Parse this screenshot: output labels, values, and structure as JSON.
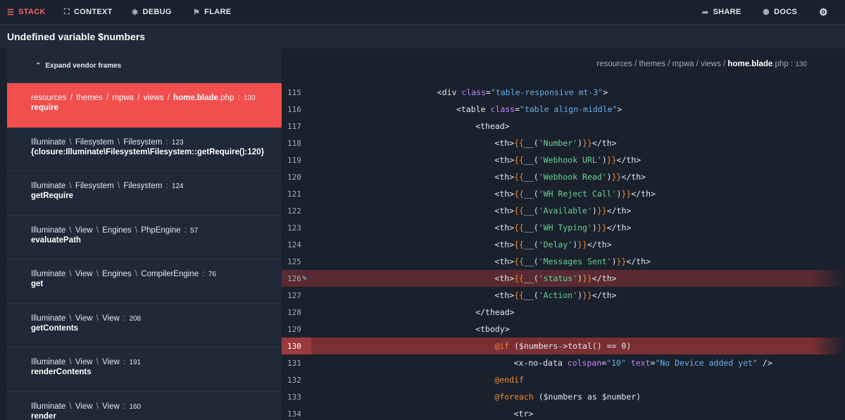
{
  "topnav": {
    "left": [
      {
        "label": "STACK",
        "icon": "list-icon",
        "glyph": "☰",
        "active": true
      },
      {
        "label": "CONTEXT",
        "icon": "expand-icon",
        "glyph": "⛶",
        "active": false
      },
      {
        "label": "DEBUG",
        "icon": "bug-icon",
        "glyph": "✱",
        "active": false
      },
      {
        "label": "FLARE",
        "icon": "flare-icon",
        "glyph": "⚑",
        "active": false
      }
    ],
    "right": [
      {
        "label": "SHARE",
        "icon": "share-icon",
        "glyph": "➦"
      },
      {
        "label": "DOCS",
        "icon": "docs-icon",
        "glyph": "⚉"
      }
    ],
    "settings_icon": "gear-icon",
    "settings_glyph": "⚙"
  },
  "title": "Undefined variable $numbers",
  "sidebar": {
    "expand_label": "Expand vendor frames",
    "expand_glyph": "⌃",
    "frames": [
      {
        "path": [
          "resources",
          "themes",
          "mpwa",
          "views"
        ],
        "file": "home.blade.php",
        "line": "130",
        "method": "require",
        "active": true
      },
      {
        "path": [
          "Illuminate",
          "Filesystem",
          "Filesystem"
        ],
        "file": "",
        "line": "123",
        "method": "{closure:Illuminate\\Filesystem\\Filesystem::getRequire():120}",
        "active": false
      },
      {
        "path": [
          "Illuminate",
          "Filesystem",
          "Filesystem"
        ],
        "file": "",
        "line": "124",
        "method": "getRequire",
        "active": false
      },
      {
        "path": [
          "Illuminate",
          "View",
          "Engines",
          "PhpEngine"
        ],
        "file": "",
        "line": "57",
        "method": "evaluatePath",
        "active": false
      },
      {
        "path": [
          "Illuminate",
          "View",
          "Engines",
          "CompilerEngine"
        ],
        "file": "",
        "line": "76",
        "method": "get",
        "active": false
      },
      {
        "path": [
          "Illuminate",
          "View",
          "View"
        ],
        "file": "",
        "line": "208",
        "method": "getContents",
        "active": false
      },
      {
        "path": [
          "Illuminate",
          "View",
          "View"
        ],
        "file": "",
        "line": "191",
        "method": "renderContents",
        "active": false
      },
      {
        "path": [
          "Illuminate",
          "View",
          "View"
        ],
        "file": "",
        "line": "160",
        "method": "render",
        "active": false
      }
    ]
  },
  "code": {
    "breadcrumb": {
      "path": [
        "resources",
        "themes",
        "mpwa",
        "views"
      ],
      "file": "home.blade",
      "ext": ".php",
      "line": "130"
    },
    "highlight_line": "130",
    "edit_line": "126",
    "lines": [
      {
        "n": "115",
        "indent": 16,
        "t": [
          [
            "tg",
            "<div "
          ],
          [
            "at",
            "class"
          ],
          [
            "tg",
            "="
          ],
          [
            "av",
            "\"table-responsive mt-3\""
          ],
          [
            "tg",
            ">"
          ]
        ]
      },
      {
        "n": "116",
        "indent": 20,
        "t": [
          [
            "tg",
            "<table "
          ],
          [
            "at",
            "class"
          ],
          [
            "tg",
            "="
          ],
          [
            "av",
            "\"table align-middle\""
          ],
          [
            "tg",
            ">"
          ]
        ]
      },
      {
        "n": "117",
        "indent": 24,
        "t": [
          [
            "tg",
            "<thead>"
          ]
        ]
      },
      {
        "n": "118",
        "indent": 28,
        "t": [
          [
            "tg",
            "<th>"
          ],
          [
            "sm",
            "{{"
          ],
          [
            "fn",
            "__("
          ],
          [
            "st",
            "'Number'"
          ],
          [
            "fn",
            ")"
          ],
          [
            "sm",
            "}}"
          ],
          [
            "tg",
            "</th>"
          ]
        ]
      },
      {
        "n": "119",
        "indent": 28,
        "t": [
          [
            "tg",
            "<th>"
          ],
          [
            "sm",
            "{{"
          ],
          [
            "fn",
            "__("
          ],
          [
            "st",
            "'Webhook URL'"
          ],
          [
            "fn",
            ")"
          ],
          [
            "sm",
            "}}"
          ],
          [
            "tg",
            "</th>"
          ]
        ]
      },
      {
        "n": "120",
        "indent": 28,
        "t": [
          [
            "tg",
            "<th>"
          ],
          [
            "sm",
            "{{"
          ],
          [
            "fn",
            "__("
          ],
          [
            "st",
            "'Webhook Read'"
          ],
          [
            "fn",
            ")"
          ],
          [
            "sm",
            "}}"
          ],
          [
            "tg",
            "</th>"
          ]
        ]
      },
      {
        "n": "121",
        "indent": 28,
        "t": [
          [
            "tg",
            "<th>"
          ],
          [
            "sm",
            "{{"
          ],
          [
            "fn",
            "__("
          ],
          [
            "st",
            "'WH Reject Call'"
          ],
          [
            "fn",
            ")"
          ],
          [
            "sm",
            "}}"
          ],
          [
            "tg",
            "</th>"
          ]
        ]
      },
      {
        "n": "122",
        "indent": 28,
        "t": [
          [
            "tg",
            "<th>"
          ],
          [
            "sm",
            "{{"
          ],
          [
            "fn",
            "__("
          ],
          [
            "st",
            "'Available'"
          ],
          [
            "fn",
            ")"
          ],
          [
            "sm",
            "}}"
          ],
          [
            "tg",
            "</th>"
          ]
        ]
      },
      {
        "n": "123",
        "indent": 28,
        "t": [
          [
            "tg",
            "<th>"
          ],
          [
            "sm",
            "{{"
          ],
          [
            "fn",
            "__("
          ],
          [
            "st",
            "'WH Typing'"
          ],
          [
            "fn",
            ")"
          ],
          [
            "sm",
            "}}"
          ],
          [
            "tg",
            "</th>"
          ]
        ]
      },
      {
        "n": "124",
        "indent": 28,
        "t": [
          [
            "tg",
            "<th>"
          ],
          [
            "sm",
            "{{"
          ],
          [
            "fn",
            "__("
          ],
          [
            "st",
            "'Delay'"
          ],
          [
            "fn",
            ")"
          ],
          [
            "sm",
            "}}"
          ],
          [
            "tg",
            "</th>"
          ]
        ]
      },
      {
        "n": "125",
        "indent": 28,
        "t": [
          [
            "tg",
            "<th>"
          ],
          [
            "sm",
            "{{"
          ],
          [
            "fn",
            "__("
          ],
          [
            "st",
            "'Messages Sent'"
          ],
          [
            "fn",
            ")"
          ],
          [
            "sm",
            "}}"
          ],
          [
            "tg",
            "</th>"
          ]
        ]
      },
      {
        "n": "126",
        "indent": 28,
        "t": [
          [
            "tg",
            "<th>"
          ],
          [
            "sm",
            "{{"
          ],
          [
            "fn",
            "__("
          ],
          [
            "st",
            "'status'"
          ],
          [
            "fn",
            ")"
          ],
          [
            "sm",
            "}}"
          ],
          [
            "tg",
            "</th>"
          ]
        ]
      },
      {
        "n": "127",
        "indent": 28,
        "t": [
          [
            "tg",
            "<th>"
          ],
          [
            "sm",
            "{{"
          ],
          [
            "fn",
            "__("
          ],
          [
            "st",
            "'Action'"
          ],
          [
            "fn",
            ")"
          ],
          [
            "sm",
            "}}"
          ],
          [
            "tg",
            "</th>"
          ]
        ]
      },
      {
        "n": "128",
        "indent": 24,
        "t": [
          [
            "tg",
            "</thead>"
          ]
        ]
      },
      {
        "n": "129",
        "indent": 24,
        "t": [
          [
            "tg",
            "<tbody>"
          ]
        ]
      },
      {
        "n": "130",
        "indent": 28,
        "t": [
          [
            "kw",
            "@if"
          ],
          [
            "fn",
            " ($numbers->total() == 0)"
          ]
        ]
      },
      {
        "n": "131",
        "indent": 32,
        "t": [
          [
            "tg",
            "<x-no-data "
          ],
          [
            "at",
            "colspan"
          ],
          [
            "tg",
            "="
          ],
          [
            "av",
            "\"10\""
          ],
          [
            "tg",
            " "
          ],
          [
            "at",
            "text"
          ],
          [
            "tg",
            "="
          ],
          [
            "av",
            "\"No Device added yet\""
          ],
          [
            "tg",
            " />"
          ]
        ]
      },
      {
        "n": "132",
        "indent": 28,
        "t": [
          [
            "kw",
            "@endif"
          ]
        ]
      },
      {
        "n": "133",
        "indent": 28,
        "t": [
          [
            "kw",
            "@foreach"
          ],
          [
            "fn",
            " ($numbers as $number)"
          ]
        ]
      },
      {
        "n": "134",
        "indent": 32,
        "t": [
          [
            "tg",
            "<tr>"
          ]
        ]
      }
    ]
  },
  "colors": {
    "accent": "#f24e4e",
    "error_line": "#7a2f33",
    "bg": "#1a202c",
    "panel": "#1f2937"
  }
}
